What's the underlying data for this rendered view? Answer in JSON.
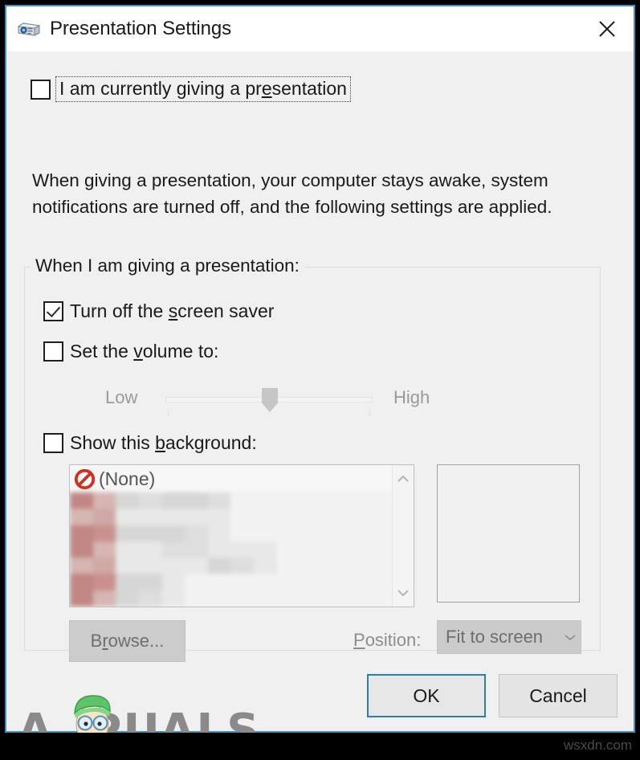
{
  "window": {
    "title": "Presentation Settings",
    "icon": "projector-icon",
    "close_label": "✕",
    "border_color": "#3f92c0"
  },
  "main": {
    "presenting_checkbox": {
      "label_prefix": "I am currently giving a pr",
      "label_accel": "e",
      "label_suffix": "sentation",
      "checked": false,
      "focused": true
    },
    "description": "When giving a presentation, your computer stays awake, system notifications are turned off, and the following settings are applied.",
    "group": {
      "legend": "When I am giving a presentation:",
      "screen_saver": {
        "label_prefix": "Turn off the ",
        "label_accel": "s",
        "label_suffix": "creen saver",
        "checked": true
      },
      "volume": {
        "label_prefix": "Set the ",
        "label_accel": "v",
        "label_suffix": "olume to:",
        "checked": false,
        "low_label": "Low",
        "high_label": "High",
        "value_percent": 50,
        "enabled": false
      },
      "background": {
        "label_prefix": "Show this ",
        "label_accel": "b",
        "label_suffix": "ackground:",
        "checked": false,
        "list": {
          "first_item_label": "(None)",
          "first_item_icon": "no-entry-icon",
          "scroll_up_icon": "chevron-up-icon",
          "scroll_down_icon": "chevron-down-icon"
        },
        "browse_button": {
          "label_prefix": "B",
          "label_accel": "r",
          "label_suffix": "owse...",
          "enabled": false
        },
        "position_label_prefix": "",
        "position_label_accel": "P",
        "position_label_suffix": "osition:",
        "position_value": "Fit to screen",
        "position_enabled": false
      }
    }
  },
  "footer": {
    "ok_label": "OK",
    "cancel_label": "Cancel",
    "default_button": "OK",
    "accent_color": "#2f7fab"
  },
  "watermark": {
    "brand_prefix": "A",
    "brand_suffix": "PUALS",
    "brand_color": "#8a8a8a",
    "source_url": "wsxdn.com"
  }
}
